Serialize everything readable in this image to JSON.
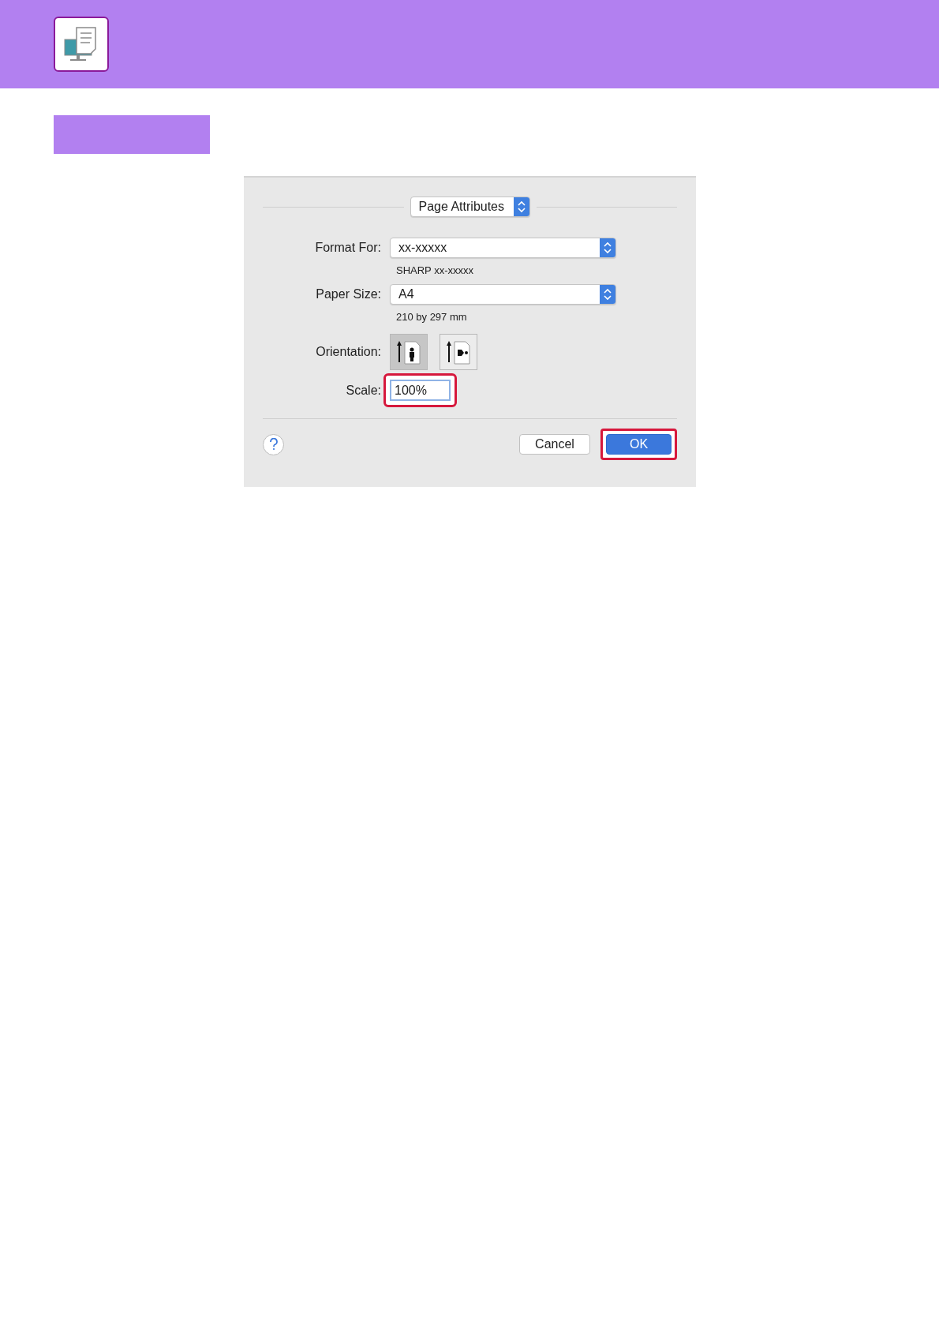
{
  "dialog": {
    "settings_popup": {
      "value": "Page Attributes"
    },
    "fields": [
      {
        "kind": "popup",
        "label": "Format For:",
        "value": "xx-xxxxx",
        "note": "SHARP xx-xxxxx"
      },
      {
        "kind": "popup",
        "label": "Paper Size:",
        "value": "A4",
        "note": "210 by 297 mm"
      },
      {
        "kind": "orientation",
        "label": "Orientation:",
        "options": [
          {
            "kind": "portrait",
            "selected": true
          },
          {
            "kind": "landscape",
            "selected": false
          }
        ]
      },
      {
        "kind": "text",
        "label": "Scale:",
        "value": "100%",
        "highlighted": true
      }
    ],
    "buttons": [
      {
        "label": "Cancel",
        "default": false,
        "highlighted": false
      },
      {
        "label": "OK",
        "default": true,
        "highlighted": true
      }
    ]
  }
}
